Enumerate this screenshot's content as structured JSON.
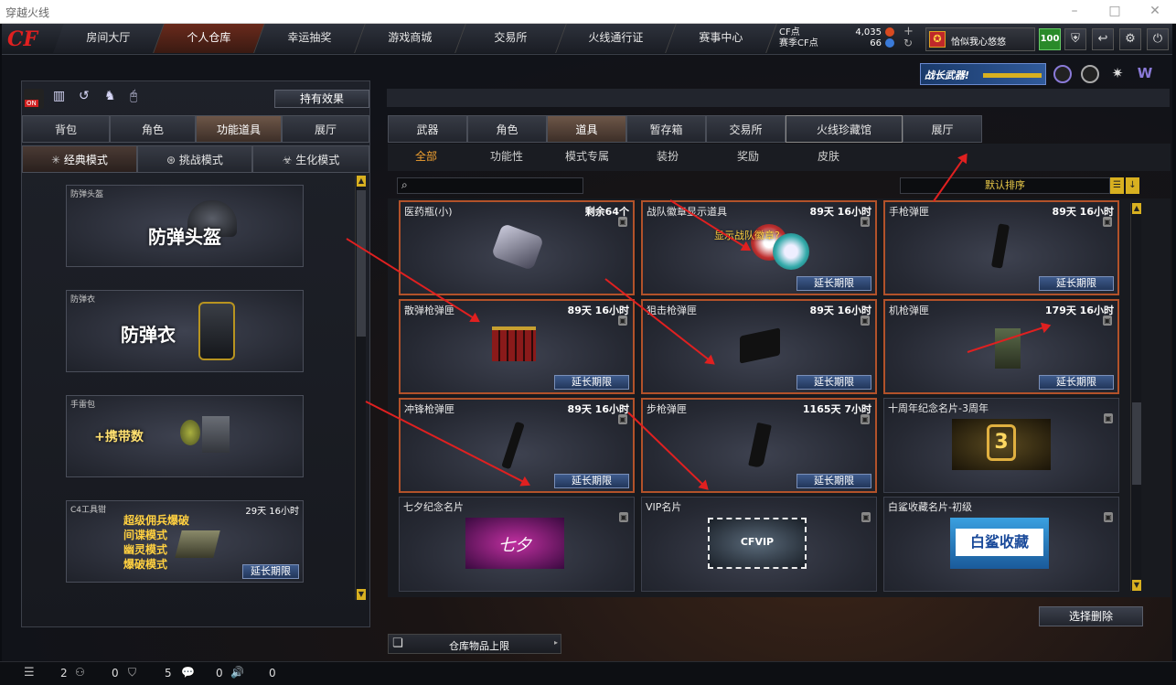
{
  "window": {
    "title": "穿越火线"
  },
  "topnav": {
    "logo": "CF",
    "tabs": [
      "房间大厅",
      "个人仓库",
      "幸运抽奖",
      "游戏商城",
      "交易所",
      "火线通行证",
      "赛事中心"
    ],
    "active": 1
  },
  "currency": {
    "cf_label": "CF点",
    "cf_value": "4,035",
    "scf_label": "赛季CF点",
    "scf_value": "66"
  },
  "player": {
    "name": "恰似我心悠悠",
    "level": "100"
  },
  "banner": {
    "text": "战长武器!"
  },
  "left": {
    "effects_button": "持有效果",
    "tabs": [
      "背包",
      "角色",
      "功能道具",
      "展厅"
    ],
    "active_tab": 2,
    "modes": [
      "经典模式",
      "挑战模式",
      "生化模式"
    ],
    "items": [
      {
        "name": "防弹头盔",
        "art": "防弹头盔"
      },
      {
        "name": "防弹衣",
        "art": "防弹衣"
      },
      {
        "name": "手雷包",
        "art": "+携带数"
      },
      {
        "name": "C4工具钳",
        "time": "29天 16小时",
        "lines": [
          "超级佣兵爆破",
          "间谍模式",
          "幽灵模式",
          "爆破模式"
        ],
        "button": "延长期限"
      }
    ]
  },
  "right": {
    "tabs": [
      "武器",
      "角色",
      "道具",
      "暂存箱",
      "交易所",
      "火线珍藏馆",
      "展厅"
    ],
    "active_tab": 2,
    "subtabs": [
      "全部",
      "功能性",
      "模式专属",
      "装扮",
      "奖励",
      "皮肤"
    ],
    "active_subtab": 0,
    "search_placeholder": "",
    "sort": "默认排序",
    "items": [
      {
        "name": "医药瓶(小)",
        "time": "剩余64个",
        "ext": ""
      },
      {
        "name": "战队徽章显示道具",
        "time": "89天 16小时",
        "ext": "延长期限",
        "overlay": "显示战队徽章?"
      },
      {
        "name": "手枪弹匣",
        "time": "89天 16小时",
        "ext": "延长期限"
      },
      {
        "name": "散弹枪弹匣",
        "time": "89天 16小时",
        "ext": "延长期限"
      },
      {
        "name": "狙击枪弹匣",
        "time": "89天 16小时",
        "ext": "延长期限"
      },
      {
        "name": "机枪弹匣",
        "time": "179天 16小时",
        "ext": "延长期限"
      },
      {
        "name": "冲锋枪弹匣",
        "time": "89天 16小时",
        "ext": "延长期限"
      },
      {
        "name": "步枪弹匣",
        "time": "1165天 7小时",
        "ext": "延长期限"
      },
      {
        "name": "十周年纪念名片-3周年",
        "time": "",
        "ext": ""
      },
      {
        "name": "七夕纪念名片",
        "time": "",
        "ext": "",
        "art": "七夕"
      },
      {
        "name": "VIP名片",
        "time": "",
        "ext": "",
        "art": "CFVIP"
      },
      {
        "name": "白鲨收藏名片-初级",
        "time": "",
        "ext": "",
        "art": "白鲨收藏"
      }
    ],
    "delete_button": "选择删除",
    "capacity_label": "仓库物品上限"
  },
  "statusbar": {
    "values": [
      "2",
      "0",
      "5",
      "0",
      "0"
    ]
  }
}
